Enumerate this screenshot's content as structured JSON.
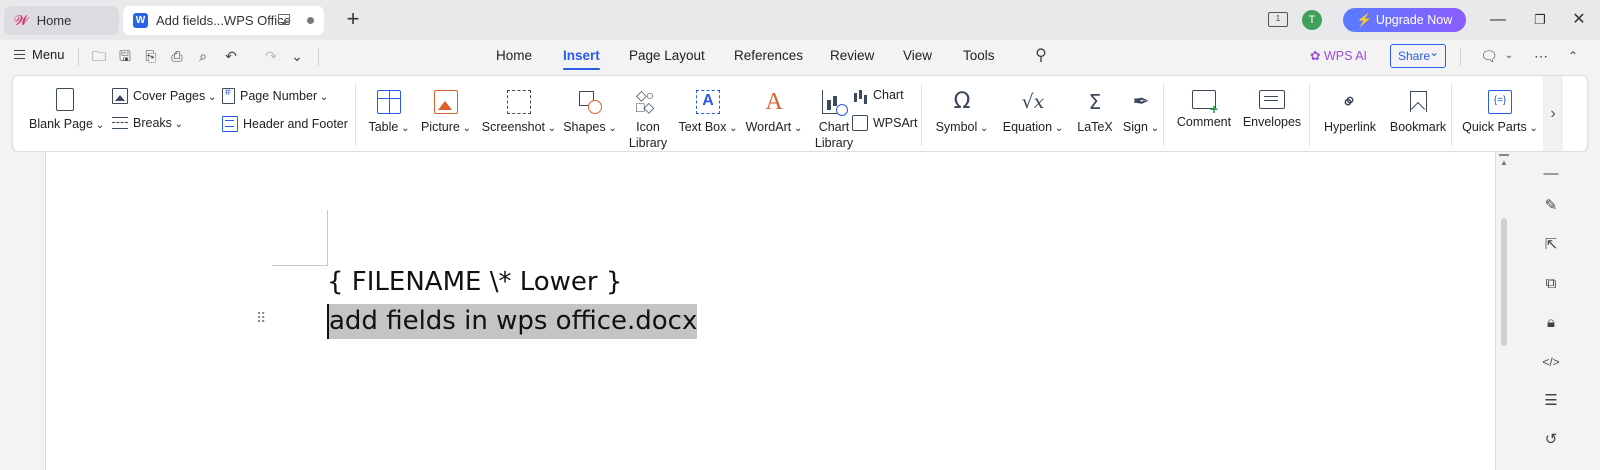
{
  "titlebar": {
    "home_tab": "Home",
    "doc_tab": "Add fields...WPS Office",
    "doc_icon_letter": "W",
    "page_indicator": "1",
    "avatar_letter": "T",
    "upgrade_label": "Upgrade Now"
  },
  "menubar": {
    "menu_label": "Menu",
    "tabs": [
      "Home",
      "Insert",
      "Page Layout",
      "References",
      "Review",
      "View",
      "Tools"
    ],
    "active_tab": "Insert",
    "wps_ai": "WPS AI",
    "share": "Share"
  },
  "ribbon": {
    "blank_page": "Blank Page",
    "cover_pages": "Cover Pages",
    "breaks": "Breaks",
    "page_number": "Page Number",
    "header_footer": "Header and Footer",
    "table": "Table",
    "picture": "Picture",
    "screenshot": "Screenshot",
    "shapes": "Shapes",
    "icon_library_1": "Icon",
    "icon_library_2": "Library",
    "text_box": "Text Box",
    "wordart": "WordArt",
    "chart_library_1": "Chart",
    "chart_library_2": "Library",
    "chart": "Chart",
    "wpsart": "WPSArt",
    "symbol": "Symbol",
    "equation": "Equation",
    "latex": "LaTeX",
    "sign": "Sign",
    "comment": "Comment",
    "envelopes": "Envelopes",
    "hyperlink": "Hyperlink",
    "bookmark": "Bookmark",
    "quick_parts": "Quick Parts"
  },
  "document": {
    "field_code": "{ FILENAME \\* Lower }",
    "field_result": "add fields in wps office.docx"
  },
  "colors": {
    "accent": "#2b5ce6",
    "upgrade_start": "#5a7cff",
    "upgrade_end": "#8a5cff",
    "wps_ai": "#9a4fd6",
    "selection": "#c4c4c4"
  }
}
